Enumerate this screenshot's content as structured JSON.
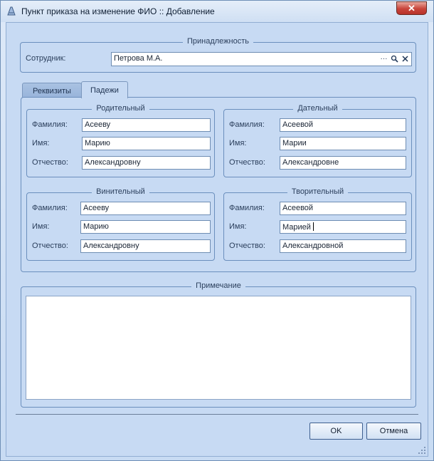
{
  "window": {
    "title": "Пункт приказа на изменение ФИО :: Добавление",
    "close_glyph": "✕"
  },
  "affiliation": {
    "legend": "Принадлежность",
    "employee_label": "Сотрудник:",
    "employee_value": "Петрова М.А.",
    "buttons": [
      "ellipsis-icon",
      "search-icon",
      "clear-icon"
    ]
  },
  "tabs": [
    {
      "label": "Реквизиты",
      "active": false
    },
    {
      "label": "Падежи",
      "active": true
    }
  ],
  "cases": {
    "labels": {
      "surname": "Фамилия:",
      "name": "Имя:",
      "patronymic": "Отчество:"
    },
    "genitive": {
      "legend": "Родительный",
      "surname": "Асееву",
      "name": "Марию",
      "patronymic": "Александровну"
    },
    "dative": {
      "legend": "Дательный",
      "surname": "Асеевой",
      "name": "Марии",
      "patronymic": "Александровне"
    },
    "accusative": {
      "legend": "Винительный",
      "surname": "Асееву",
      "name": "Марию",
      "patronymic": "Александровну"
    },
    "instrumental": {
      "legend": "Творительный",
      "surname": "Асеевой",
      "name": "Марией",
      "patronymic": "Александровной"
    }
  },
  "note": {
    "legend": "Примечание",
    "value": ""
  },
  "footer": {
    "ok_label": "OK",
    "cancel_label": "Отмена"
  },
  "colors": {
    "background": "#c7daf3",
    "border": "#6b8fbd",
    "close_button": "#c8443a"
  }
}
